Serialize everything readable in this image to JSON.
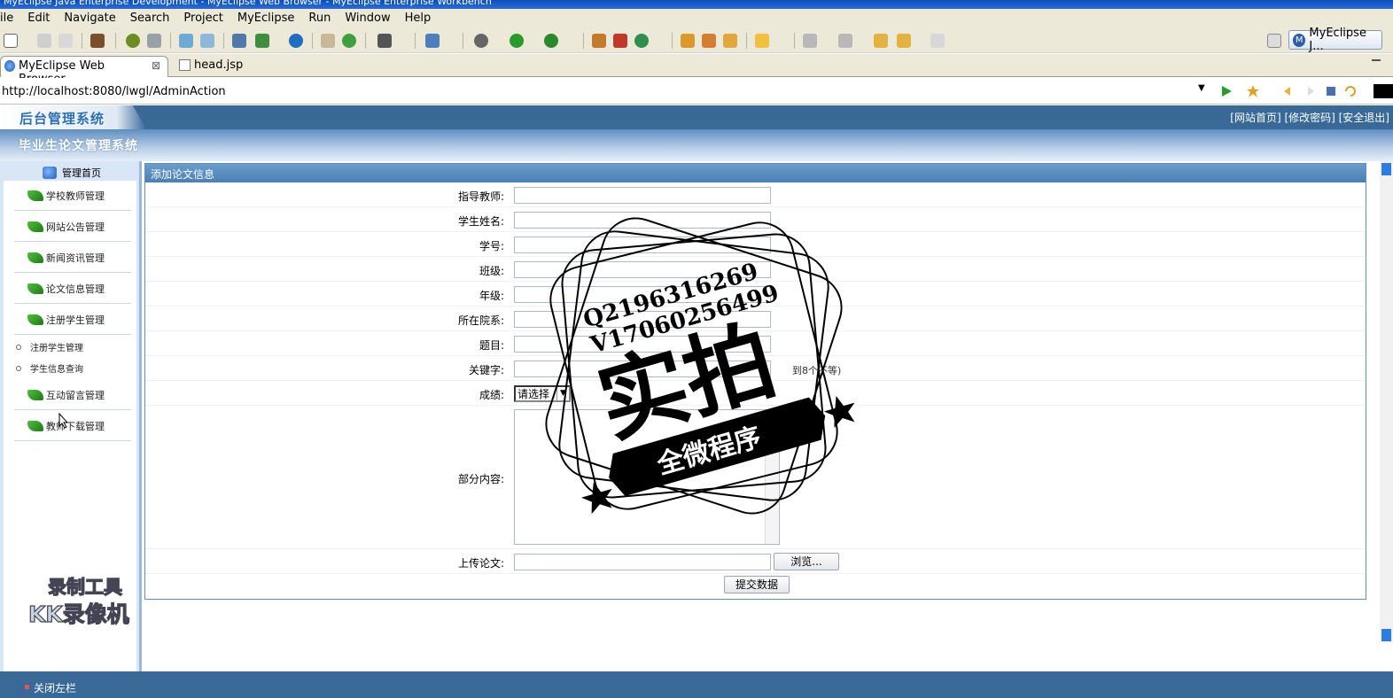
{
  "window": {
    "title": "MyEclipse Java Enterprise Development - MyEclipse Web Browser - MyEclipse Enterprise Workbench"
  },
  "menus": [
    "ile",
    "Edit",
    "Navigate",
    "Search",
    "Project",
    "MyEclipse",
    "Run",
    "Window",
    "Help"
  ],
  "perspective": {
    "label": "MyEclipse J..."
  },
  "tabs": [
    {
      "label": "MyEclipse Web Browser",
      "close": "⊠"
    },
    {
      "label": "head.jsp"
    }
  ],
  "address": {
    "url": "http://localhost:8080/lwgl/AdminAction"
  },
  "page": {
    "logo": "后台管理系统",
    "top_links": "[网站首页] [修改密码] [安全退出]",
    "system_name": "毕业生论文管理系统",
    "home": "管理首页",
    "sidebar": {
      "items": [
        {
          "label": "学校教师管理"
        },
        {
          "label": "网站公告管理"
        },
        {
          "label": "新闻资讯管理"
        },
        {
          "label": "论文信息管理"
        },
        {
          "label": "注册学生管理"
        },
        {
          "label": "互动留言管理"
        },
        {
          "label": "教师下载管理"
        }
      ],
      "sub_items": [
        {
          "label": "注册学生管理"
        },
        {
          "label": "学生信息查询"
        }
      ]
    },
    "panel_title": "添加论文信息",
    "form": {
      "advisor": "指导教师:",
      "student_name": "学生姓名:",
      "student_no": "学号:",
      "class": "班级:",
      "grade_year": "年级:",
      "department": "所在院系:",
      "topic": "题目:",
      "keywords": "关键字:",
      "keywords_hint": "到8个不等)",
      "score": "成绩:",
      "score_selected": "请选择",
      "content": "部分内容:",
      "upload": "上传论文:",
      "browse": "浏览...",
      "submit": "提交数据"
    },
    "footer": "关闭左栏"
  },
  "watermark": {
    "line1": "Q2196316269",
    "line2": "V17060256499",
    "big": "实拍",
    "banner": "全微程序"
  },
  "recorder": {
    "line1": "录制工具",
    "line2": "KK录像机"
  }
}
